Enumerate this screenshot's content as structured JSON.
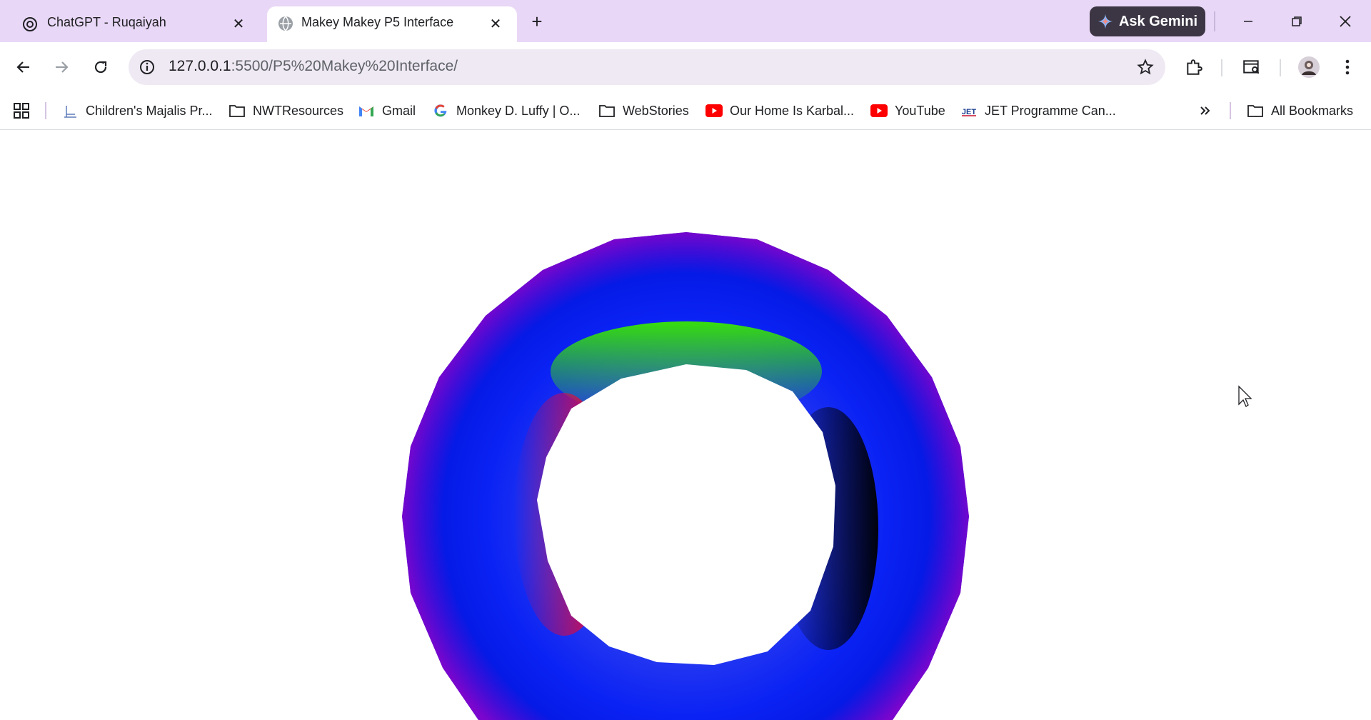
{
  "tabs": [
    {
      "title": "ChatGPT - Ruqaiyah",
      "icon": "chatgpt-icon",
      "active": false
    },
    {
      "title": "Makey Makey P5 Interface",
      "icon": "globe-icon",
      "active": true
    }
  ],
  "gemini": {
    "label": "Ask Gemini"
  },
  "address": {
    "host": "127.0.0.1",
    "rest": ":5500/P5%20Makey%20Interface/"
  },
  "bookmarks": [
    {
      "label": "Children's Majalis Pr...",
      "icon": "site-icon"
    },
    {
      "label": "NWTResources",
      "icon": "folder-icon"
    },
    {
      "label": "Gmail",
      "icon": "gmail-icon"
    },
    {
      "label": "Monkey D. Luffy | O...",
      "icon": "google-icon"
    },
    {
      "label": "WebStories",
      "icon": "folder-icon"
    },
    {
      "label": "Our Home Is Karbal...",
      "icon": "youtube-icon"
    },
    {
      "label": "YouTube",
      "icon": "youtube-icon"
    },
    {
      "label": "JET Programme Can...",
      "icon": "jet-icon"
    }
  ],
  "all_bookmarks": {
    "label": "All Bookmarks"
  },
  "colors": {
    "titlebar": "#e9d7f7",
    "omnibox": "#efe9f3",
    "torus_blue": "#0019f0",
    "torus_green": "#39e800",
    "torus_red": "#ff0022"
  }
}
